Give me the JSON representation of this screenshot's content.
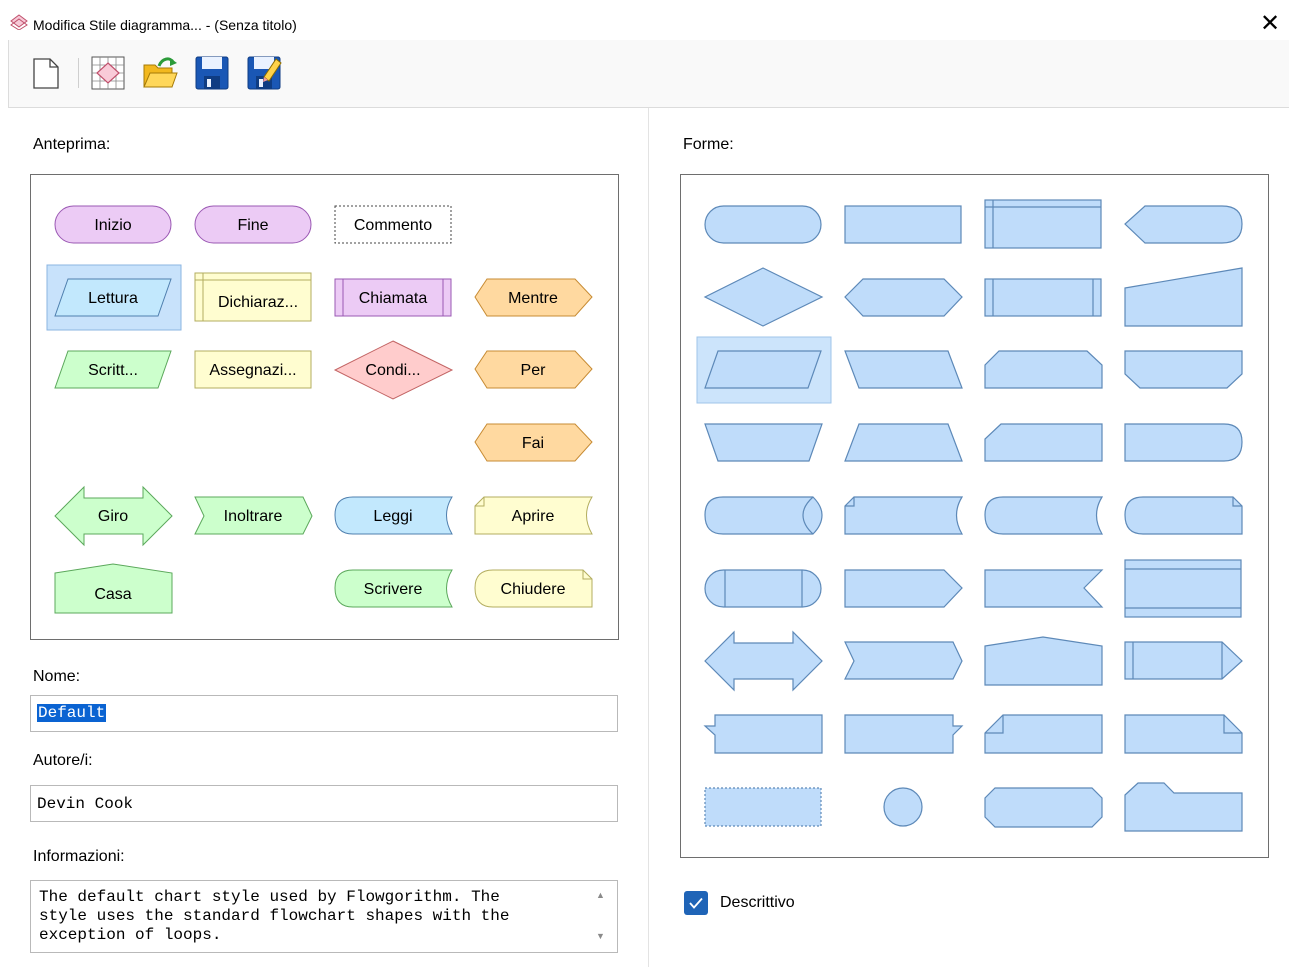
{
  "window": {
    "title": "Modifica Stile diagramma... - (Senza titolo)",
    "close_glyph": "✕"
  },
  "toolbar": {
    "buttons": [
      {
        "name": "new-document-icon"
      },
      {
        "name": "diagram-style-icon"
      },
      {
        "name": "open-folder-icon"
      },
      {
        "name": "save-icon"
      },
      {
        "name": "save-as-icon"
      }
    ]
  },
  "preview": {
    "label": "Anteprima:",
    "shapes": {
      "inizio": "Inizio",
      "fine": "Fine",
      "commento": "Commento",
      "lettura": "Lettura",
      "dichiarazione": "Dichiaraz...",
      "chiamata": "Chiamata",
      "mentre": "Mentre",
      "scrittura": "Scritt...",
      "assegnazione": "Assegnazi...",
      "condizione": "Condi...",
      "per": "Per",
      "fai": "Fai",
      "giro": "Giro",
      "inoltrare": "Inoltrare",
      "leggi": "Leggi",
      "aprire": "Aprire",
      "casa": "Casa",
      "scrivere": "Scrivere",
      "chiudere": "Chiudere"
    }
  },
  "shapes_panel": {
    "label": "Forme:"
  },
  "form": {
    "nome_label": "Nome:",
    "nome_value": "Default",
    "autore_label": "Autore/i:",
    "autore_value": "Devin Cook",
    "info_label": "Informazioni:",
    "info_value": "The default chart style used by Flowgorithm. The\nstyle uses the standard flowchart shapes with the\nexception of loops."
  },
  "descrittivo": {
    "label": "Descrittivo",
    "checked": true
  },
  "colors": {
    "accent": "#1f64b7",
    "shape_blue_fill": "#bfdcfa",
    "shape_blue_stroke": "#5d89b8",
    "terminal_fill": "#eccbf5",
    "input_fill": "#c2e8fd",
    "declare_fill": "#fffdd0",
    "decision_fill": "#ffcccc",
    "loop_fill": "#ffd9a0",
    "output_fill": "#ccffcc"
  }
}
